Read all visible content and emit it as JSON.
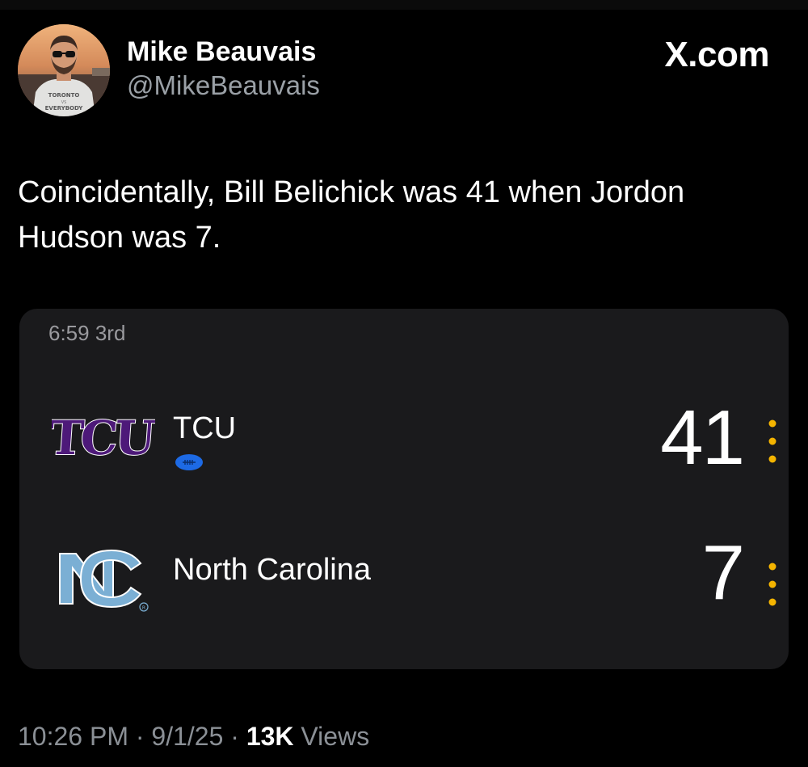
{
  "author": {
    "display_name": "Mike Beauvais",
    "handle": "@MikeBeauvais",
    "avatar_shirt_text": "TORONTO VS EVERYBODY"
  },
  "brand": {
    "label": "X.com"
  },
  "tweet": {
    "text": "Coincidentally, Bill Belichick was 41 when Jordon Hudson was 7."
  },
  "scorecard": {
    "game_clock": "6:59 3rd",
    "teams": [
      {
        "name": "TCU",
        "logo_text": "TCU",
        "score": "41",
        "has_possession": true,
        "logo_color": "#4d1979"
      },
      {
        "name": "North Carolina",
        "logo_text": "NC",
        "score": "7",
        "has_possession": false,
        "logo_color": "#7bafd4"
      }
    ],
    "possession_color": "#1d6ae5",
    "menu_dot_color": "#f4b400",
    "menu_icon": "vertical-ellipsis-icon"
  },
  "footer": {
    "time": "10:26 PM",
    "separator": "·",
    "date": "9/1/25",
    "views_count": "13K",
    "views_label": "Views"
  }
}
